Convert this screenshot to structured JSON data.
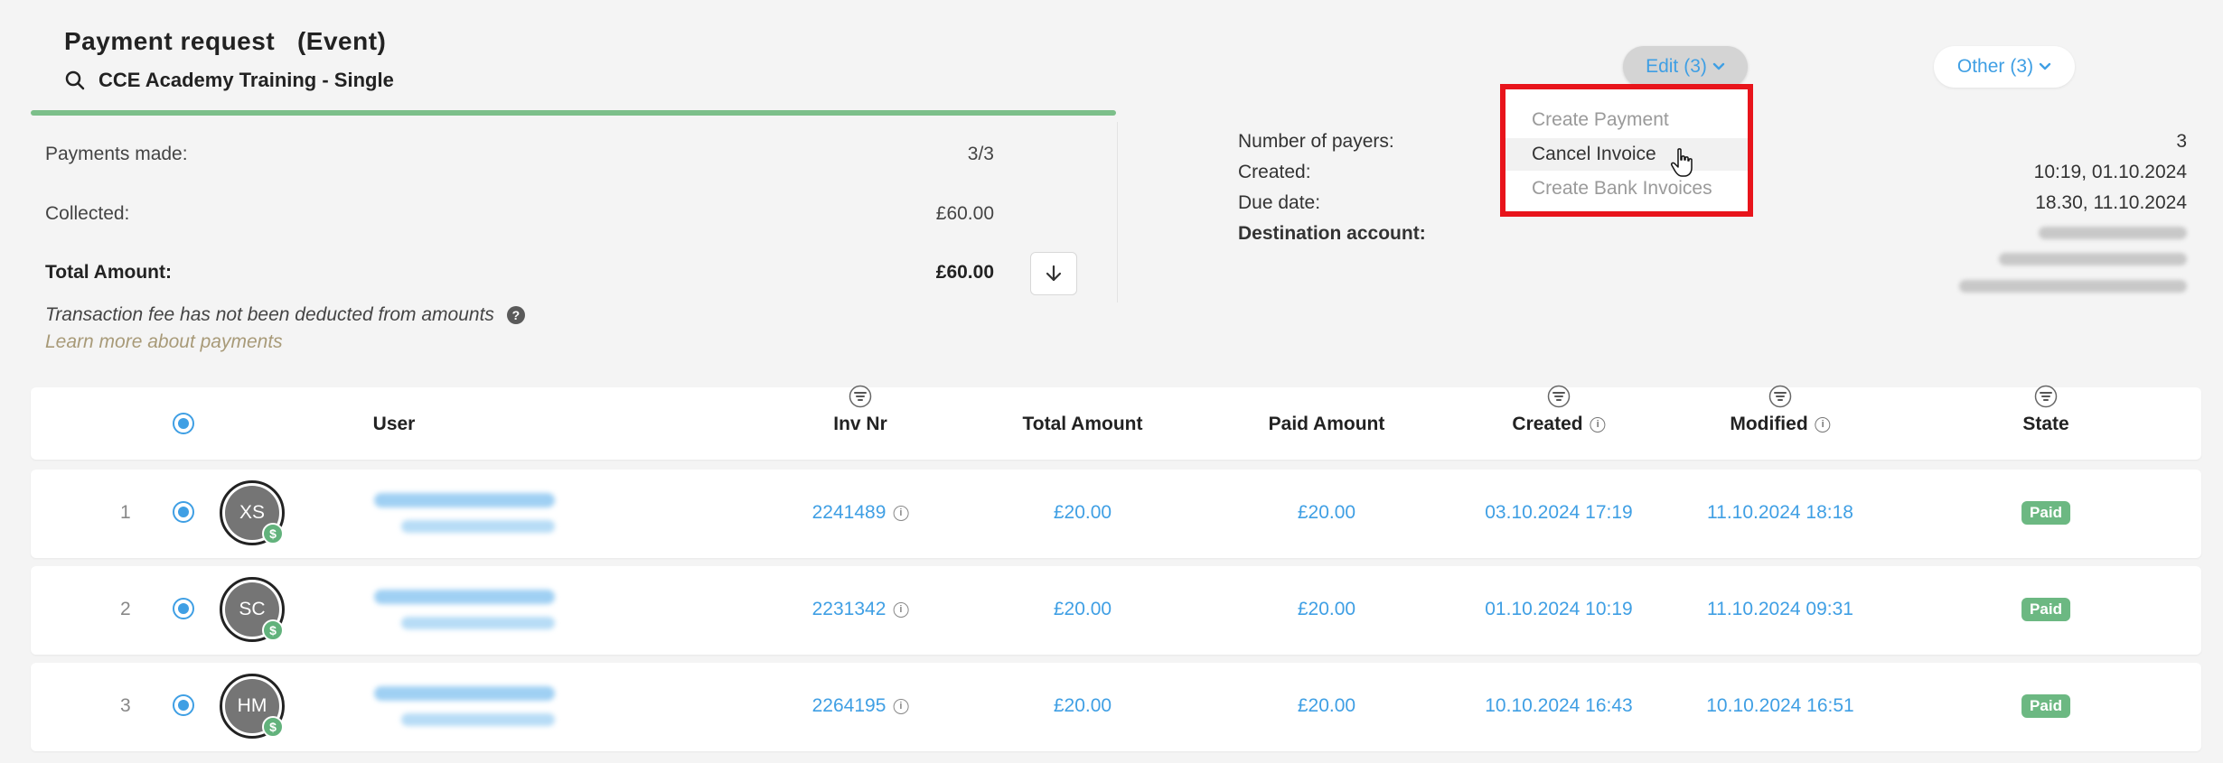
{
  "header": {
    "title": "Payment request   (Event)",
    "event_name": "CCE Academy Training - Single"
  },
  "progress": {
    "paid_fraction": 1.0
  },
  "summary": {
    "payments_made_label": "Payments made:",
    "payments_made_value": "3/3",
    "collected_label": "Collected:",
    "collected_value": "£60.00",
    "total_label": "Total Amount:",
    "total_value": "£60.00",
    "fee_note": "Transaction fee has not been deducted from amounts",
    "learn_more": "Learn more about payments"
  },
  "actions": {
    "edit_label": "Edit",
    "edit_count": "(3)",
    "other_label": "Other",
    "other_count": "(3)"
  },
  "edit_menu": {
    "items": [
      {
        "label": "Create Payment",
        "state": "disabled"
      },
      {
        "label": "Cancel Invoice",
        "state": "hover"
      },
      {
        "label": "Create Bank Invoices",
        "state": "disabled"
      }
    ]
  },
  "details": {
    "payers_label": "Number of payers:",
    "payers_value": "3",
    "created_label": "Created:",
    "created_value": "10:19, 01.10.2024",
    "due_label": "Due date:",
    "due_value": "18.30, 11.10.2024",
    "destination_label": "Destination account:"
  },
  "table": {
    "columns": {
      "user": "User",
      "inv_nr": "Inv Nr",
      "total_amount": "Total Amount",
      "paid_amount": "Paid Amount",
      "created": "Created",
      "modified": "Modified",
      "state": "State"
    },
    "rows": [
      {
        "num": "1",
        "initials": "XS",
        "inv_nr": "2241489",
        "total": "£20.00",
        "paid": "£20.00",
        "created": "03.10.2024 17:19",
        "modified": "11.10.2024 18:18",
        "state": "Paid"
      },
      {
        "num": "2",
        "initials": "SC",
        "inv_nr": "2231342",
        "total": "£20.00",
        "paid": "£20.00",
        "created": "01.10.2024 10:19",
        "modified": "11.10.2024 09:31",
        "state": "Paid"
      },
      {
        "num": "3",
        "initials": "HM",
        "inv_nr": "2264195",
        "total": "£20.00",
        "paid": "£20.00",
        "created": "10.10.2024 16:43",
        "modified": "10.10.2024 16:51",
        "state": "Paid"
      }
    ]
  },
  "colors": {
    "accent": "#3f9fe4",
    "paid_green": "#6cb882",
    "progress_green": "#7cbf8a",
    "highlight_red": "#e8141b"
  },
  "icons": {
    "search": "search-icon",
    "download": "arrow-down-icon",
    "help": "question-circle-icon",
    "filter": "filter-icon",
    "info": "info-icon",
    "chevron": "chevron-down-icon",
    "coin": "dollar-coin-icon",
    "cursor": "hand-pointer-icon"
  }
}
